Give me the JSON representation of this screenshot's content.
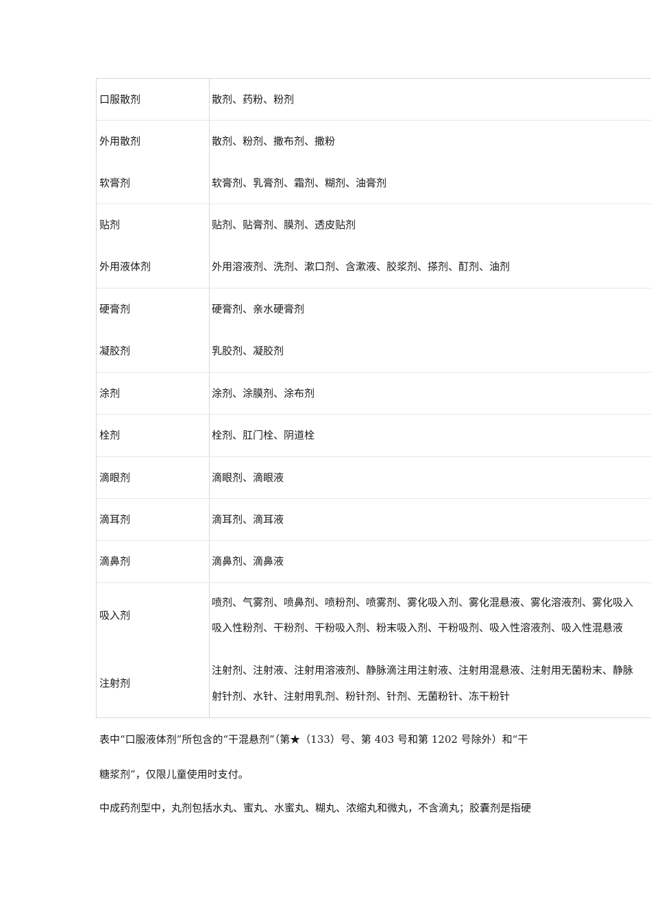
{
  "table": {
    "rows": [
      {
        "name": "口服散剂",
        "items": [
          "散剂、药粉、粉剂"
        ]
      },
      {
        "name": "外用散剂",
        "items": [
          "散剂、粉剂、撒布剂、撒粉"
        ]
      },
      {
        "name": "软膏剂",
        "items": [
          "软膏剂、乳膏剂、霜剂、糊剂、油膏剂"
        ]
      },
      {
        "name": "贴剂",
        "items": [
          "贴剂、贴膏剂、膜剂、透皮贴剂"
        ]
      },
      {
        "name": "外用液体剂",
        "items": [
          "外用溶液剂、洗剂、漱口剂、含漱液、胶浆剂、搽剂、酊剂、油剂"
        ]
      },
      {
        "name": "硬膏剂",
        "items": [
          "硬膏剂、亲水硬膏剂"
        ]
      },
      {
        "name": "凝胶剂",
        "items": [
          "乳胶剂、凝胶剂"
        ]
      },
      {
        "name": "涂剂",
        "items": [
          "涂剂、涂膜剂、涂布剂"
        ]
      },
      {
        "name": "栓剂",
        "items": [
          "栓剂、肛门栓、阴道栓"
        ]
      },
      {
        "name": "滴眼剂",
        "items": [
          "滴眼剂、滴眼液"
        ]
      },
      {
        "name": "滴耳剂",
        "items": [
          "滴耳剂、滴耳液"
        ]
      },
      {
        "name": "滴鼻剂",
        "items": [
          "滴鼻剂、滴鼻液"
        ]
      },
      {
        "name": "吸入剂",
        "items": [
          "喷剂、气雾剂、喷鼻剂、喷粉剂、喷雾剂、雾化吸入剂、雾化混悬液、雾化溶液剂、雾化吸入",
          "吸入性粉剂、干粉剂、干粉吸入剂、粉末吸入剂、干粉吸剂、吸入性溶液剂、吸入性混悬液"
        ]
      },
      {
        "name": "注射剂",
        "items": [
          "注射剂、注射液、注射用溶液剂、静脉滴注用注射液、注射用混悬液、注射用无菌粉末、静脉",
          "射针剂、水针、注射用乳剂、粉针剂、针剂、无菌粉针、冻干粉针"
        ]
      }
    ]
  },
  "notes": {
    "line1": "表中“口服液体剂”所包含的“干混悬剂”（第★（133）号、第 403 号和第 1202 号除外）和“干",
    "line2": "糖浆剂”，仅限儿童使用时支付。",
    "line3": "中成药剂型中，丸剂包括水丸、蜜丸、水蜜丸、糊丸、浓缩丸和微丸，不含滴丸；胶囊剂是指硬"
  }
}
